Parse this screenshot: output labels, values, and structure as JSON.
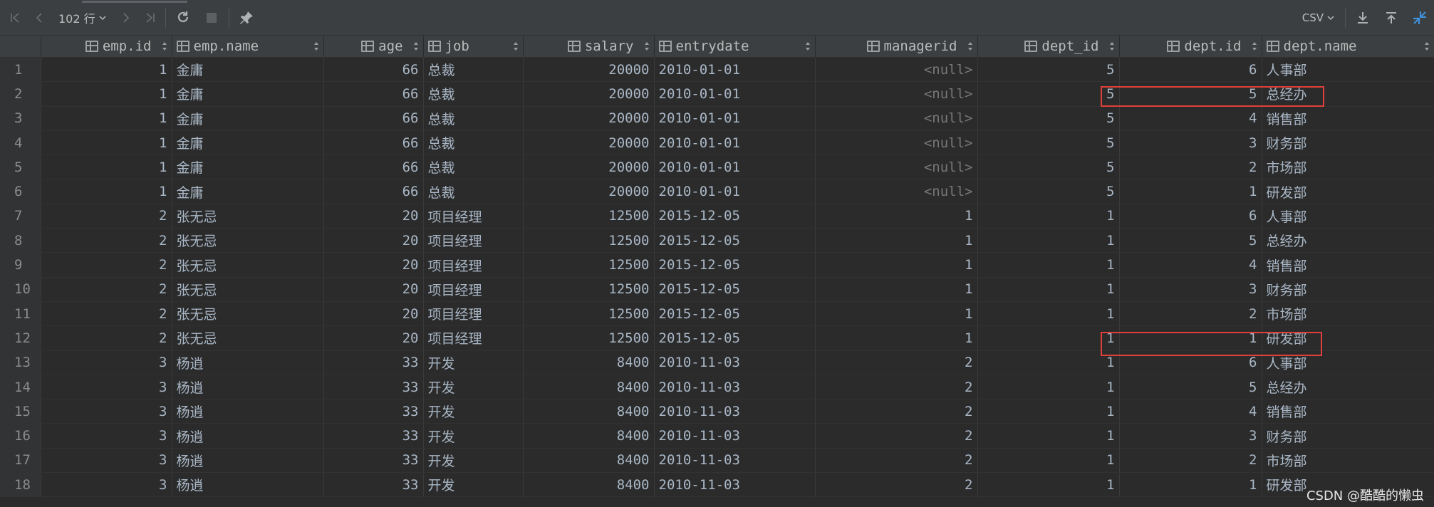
{
  "toolbar": {
    "rows_label": "102 行",
    "format_label": "CSV"
  },
  "columns": [
    {
      "label": "emp.id",
      "align": "right"
    },
    {
      "label": "emp.name",
      "align": "left"
    },
    {
      "label": "age",
      "align": "right"
    },
    {
      "label": "job",
      "align": "left"
    },
    {
      "label": "salary",
      "align": "right"
    },
    {
      "label": "entrydate",
      "align": "left"
    },
    {
      "label": "managerid",
      "align": "right"
    },
    {
      "label": "dept_id",
      "align": "right"
    },
    {
      "label": "dept.id",
      "align": "right"
    },
    {
      "label": "dept.name",
      "align": "left"
    }
  ],
  "rows": [
    [
      "1",
      "1",
      "金庸",
      "66",
      "总裁",
      "20000",
      "2010-01-01",
      "<null>",
      "5",
      "6",
      "人事部"
    ],
    [
      "2",
      "1",
      "金庸",
      "66",
      "总裁",
      "20000",
      "2010-01-01",
      "<null>",
      "5",
      "5",
      "总经办"
    ],
    [
      "3",
      "1",
      "金庸",
      "66",
      "总裁",
      "20000",
      "2010-01-01",
      "<null>",
      "5",
      "4",
      "销售部"
    ],
    [
      "4",
      "1",
      "金庸",
      "66",
      "总裁",
      "20000",
      "2010-01-01",
      "<null>",
      "5",
      "3",
      "财务部"
    ],
    [
      "5",
      "1",
      "金庸",
      "66",
      "总裁",
      "20000",
      "2010-01-01",
      "<null>",
      "5",
      "2",
      "市场部"
    ],
    [
      "6",
      "1",
      "金庸",
      "66",
      "总裁",
      "20000",
      "2010-01-01",
      "<null>",
      "5",
      "1",
      "研发部"
    ],
    [
      "7",
      "2",
      "张无忌",
      "20",
      "项目经理",
      "12500",
      "2015-12-05",
      "1",
      "1",
      "6",
      "人事部"
    ],
    [
      "8",
      "2",
      "张无忌",
      "20",
      "项目经理",
      "12500",
      "2015-12-05",
      "1",
      "1",
      "5",
      "总经办"
    ],
    [
      "9",
      "2",
      "张无忌",
      "20",
      "项目经理",
      "12500",
      "2015-12-05",
      "1",
      "1",
      "4",
      "销售部"
    ],
    [
      "10",
      "2",
      "张无忌",
      "20",
      "项目经理",
      "12500",
      "2015-12-05",
      "1",
      "1",
      "3",
      "财务部"
    ],
    [
      "11",
      "2",
      "张无忌",
      "20",
      "项目经理",
      "12500",
      "2015-12-05",
      "1",
      "1",
      "2",
      "市场部"
    ],
    [
      "12",
      "2",
      "张无忌",
      "20",
      "项目经理",
      "12500",
      "2015-12-05",
      "1",
      "1",
      "1",
      "研发部"
    ],
    [
      "13",
      "3",
      "杨逍",
      "33",
      "开发",
      "8400",
      "2010-11-03",
      "2",
      "1",
      "6",
      "人事部"
    ],
    [
      "14",
      "3",
      "杨逍",
      "33",
      "开发",
      "8400",
      "2010-11-03",
      "2",
      "1",
      "5",
      "总经办"
    ],
    [
      "15",
      "3",
      "杨逍",
      "33",
      "开发",
      "8400",
      "2010-11-03",
      "2",
      "1",
      "4",
      "销售部"
    ],
    [
      "16",
      "3",
      "杨逍",
      "33",
      "开发",
      "8400",
      "2010-11-03",
      "2",
      "1",
      "3",
      "财务部"
    ],
    [
      "17",
      "3",
      "杨逍",
      "33",
      "开发",
      "8400",
      "2010-11-03",
      "2",
      "1",
      "2",
      "市场部"
    ],
    [
      "18",
      "3",
      "杨逍",
      "33",
      "开发",
      "8400",
      "2010-11-03",
      "2",
      "1",
      "1",
      "研发部"
    ]
  ],
  "highlight_color": "#e0403a",
  "watermark": "CSDN @酷酷的懒虫"
}
